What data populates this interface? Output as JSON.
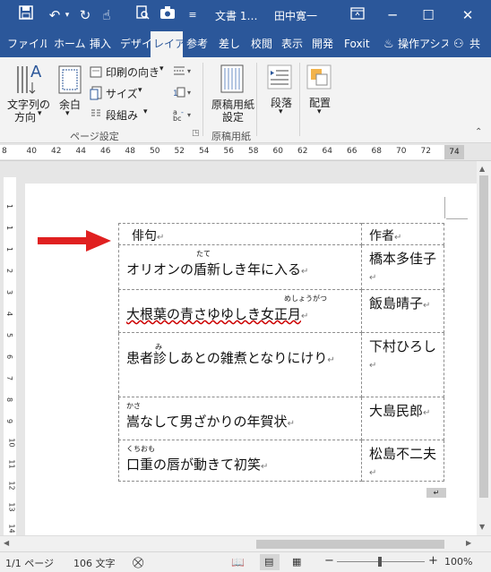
{
  "titlebar": {
    "doc_title": "文書 1…",
    "user": "田中寛一",
    "minimize": "─",
    "restore": "☐",
    "close": "✕"
  },
  "tabs": [
    "ファイル",
    "ホーム",
    "挿入",
    "デザイ",
    "レイア",
    "参考",
    "差し",
    "校閲",
    "表示",
    "開発",
    "Foxit",
    "操作アシス",
    "共"
  ],
  "ribbon": {
    "text_direction": "文字列の\n方向",
    "text_direction_l1": "文字列の",
    "text_direction_l2": "方向",
    "margins": "余白",
    "orientation": "印刷の向き",
    "size": "サイズ",
    "columns": "段組み",
    "page_setup_group": "ページ設定",
    "manuscript_l1": "原稿用紙",
    "manuscript_l2": "設定",
    "manuscript_group": "原稿用紙",
    "paragraph": "段落",
    "arrange": "配置"
  },
  "ruler_numbers": [
    "8",
    "40",
    "42",
    "44",
    "46",
    "48",
    "50",
    "52",
    "54",
    "56",
    "58",
    "60",
    "62",
    "64",
    "66",
    "68",
    "70",
    "72",
    "74"
  ],
  "table": {
    "header_haiku": "俳句",
    "header_author": "作者",
    "rows": [
      {
        "haiku": "オリオンの盾新しき年に入る",
        "ruby": "たて",
        "author": "橋本多佳子"
      },
      {
        "haiku": "大根葉の青さゆゆしき女正月",
        "ruby": "めしょうがつ",
        "author": "飯島晴子"
      },
      {
        "haiku": "患者診しあとの雑煮となりにけり",
        "ruby": "み",
        "author": "下村ひろし"
      },
      {
        "haiku": "嵩なして男ざかりの年賀状",
        "ruby": "かさ",
        "author": "大島民郎"
      },
      {
        "haiku": "口重の唇が動きて初笑",
        "ruby": "くちおも",
        "author": "松島不二夫"
      }
    ]
  },
  "status": {
    "page": "1/1 ページ",
    "words": "106 文字",
    "zoom": "100%"
  },
  "colors": {
    "brand": "#2b579a",
    "arrow": "#e02020"
  }
}
